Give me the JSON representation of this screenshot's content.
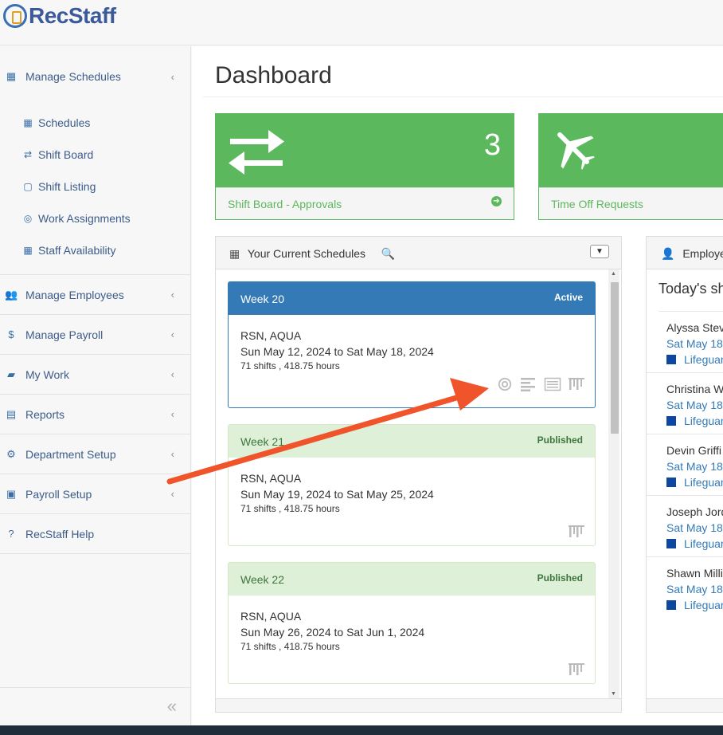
{
  "brand": {
    "name": "RecStaff"
  },
  "sidebar": {
    "manage_schedules": "Manage Schedules",
    "sub": [
      "Schedules",
      "Shift Board",
      "Shift Listing",
      "Work Assignments",
      "Staff Availability"
    ],
    "groups": [
      "Manage Employees",
      "Manage Payroll",
      "My Work",
      "Reports",
      "Department Setup",
      "Payroll Setup"
    ],
    "help": "RecStaff Help"
  },
  "page": {
    "title": "Dashboard"
  },
  "stats": [
    {
      "label": "Shift Board - Approvals",
      "count": "3"
    },
    {
      "label": "Time Off Requests"
    }
  ],
  "schedules_panel": {
    "title": "Your Current Schedules",
    "cards": [
      {
        "week": "Week 20",
        "status": "Active",
        "location": "RSN, AQUA",
        "dates": "Sun May 12, 2024 to Sat May 18, 2024",
        "meta": "71 shifts , 418.75 hours"
      },
      {
        "week": "Week 21",
        "status": "Published",
        "location": "RSN, AQUA",
        "dates": "Sun May 19, 2024 to Sat May 25, 2024",
        "meta": "71 shifts , 418.75 hours"
      },
      {
        "week": "Week 22",
        "status": "Published",
        "location": "RSN, AQUA",
        "dates": "Sun May 26, 2024 to Sat Jun 1, 2024",
        "meta": "71 shifts , 418.75 hours"
      }
    ]
  },
  "employee_panel": {
    "title": "Employee",
    "subtitle": "Today's sh",
    "rows": [
      {
        "name": "Alyssa Stev",
        "date": "Sat May 18",
        "role": "Lifeguar"
      },
      {
        "name": "Christina W",
        "date": "Sat May 18",
        "role": "Lifeguar"
      },
      {
        "name": "Devin Griffi",
        "date": "Sat May 18",
        "role": "Lifeguar"
      },
      {
        "name": "Joseph Jord",
        "date": "Sat May 18",
        "role": "Lifeguar"
      },
      {
        "name": "Shawn Milli",
        "date": "Sat May 18",
        "role": "Lifeguar"
      }
    ]
  },
  "colors": {
    "success": "#5cb85c",
    "primary": "#337ab7",
    "annotation_arrow": "#f0542a"
  }
}
